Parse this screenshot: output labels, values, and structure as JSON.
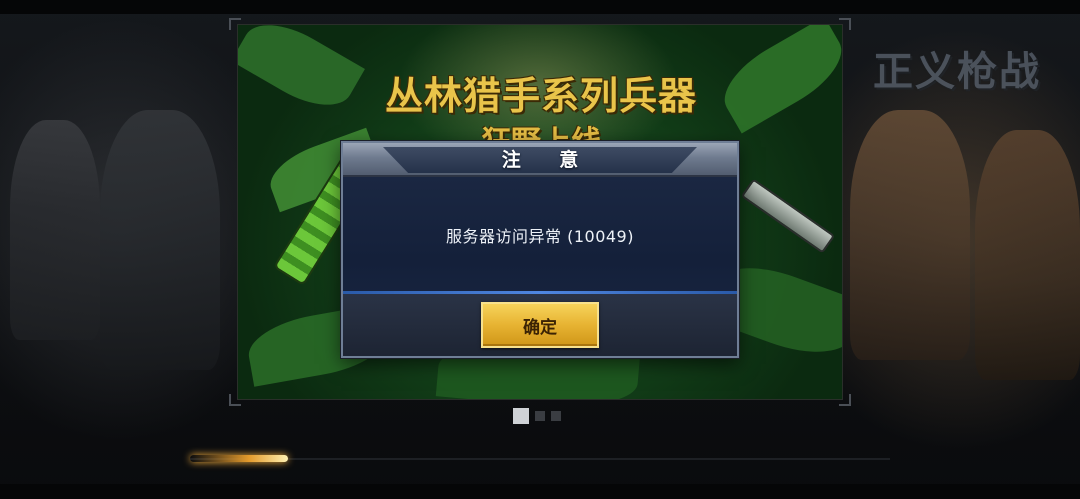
{
  "game": {
    "logo_text": "正义枪战"
  },
  "banner": {
    "title": "丛林猎手系列兵器",
    "subtitle": "狂野上线"
  },
  "carousel": {
    "pages": 3,
    "active_index": 0
  },
  "loading": {
    "progress": 0.14
  },
  "dialog": {
    "title": "注 意",
    "message": "服务器访问异常 (10049)",
    "confirm_label": "确定"
  },
  "colors": {
    "accent_gold": "#e7b332",
    "dialog_bg": "#1d2a45",
    "divider_blue": "#4f86e0"
  }
}
